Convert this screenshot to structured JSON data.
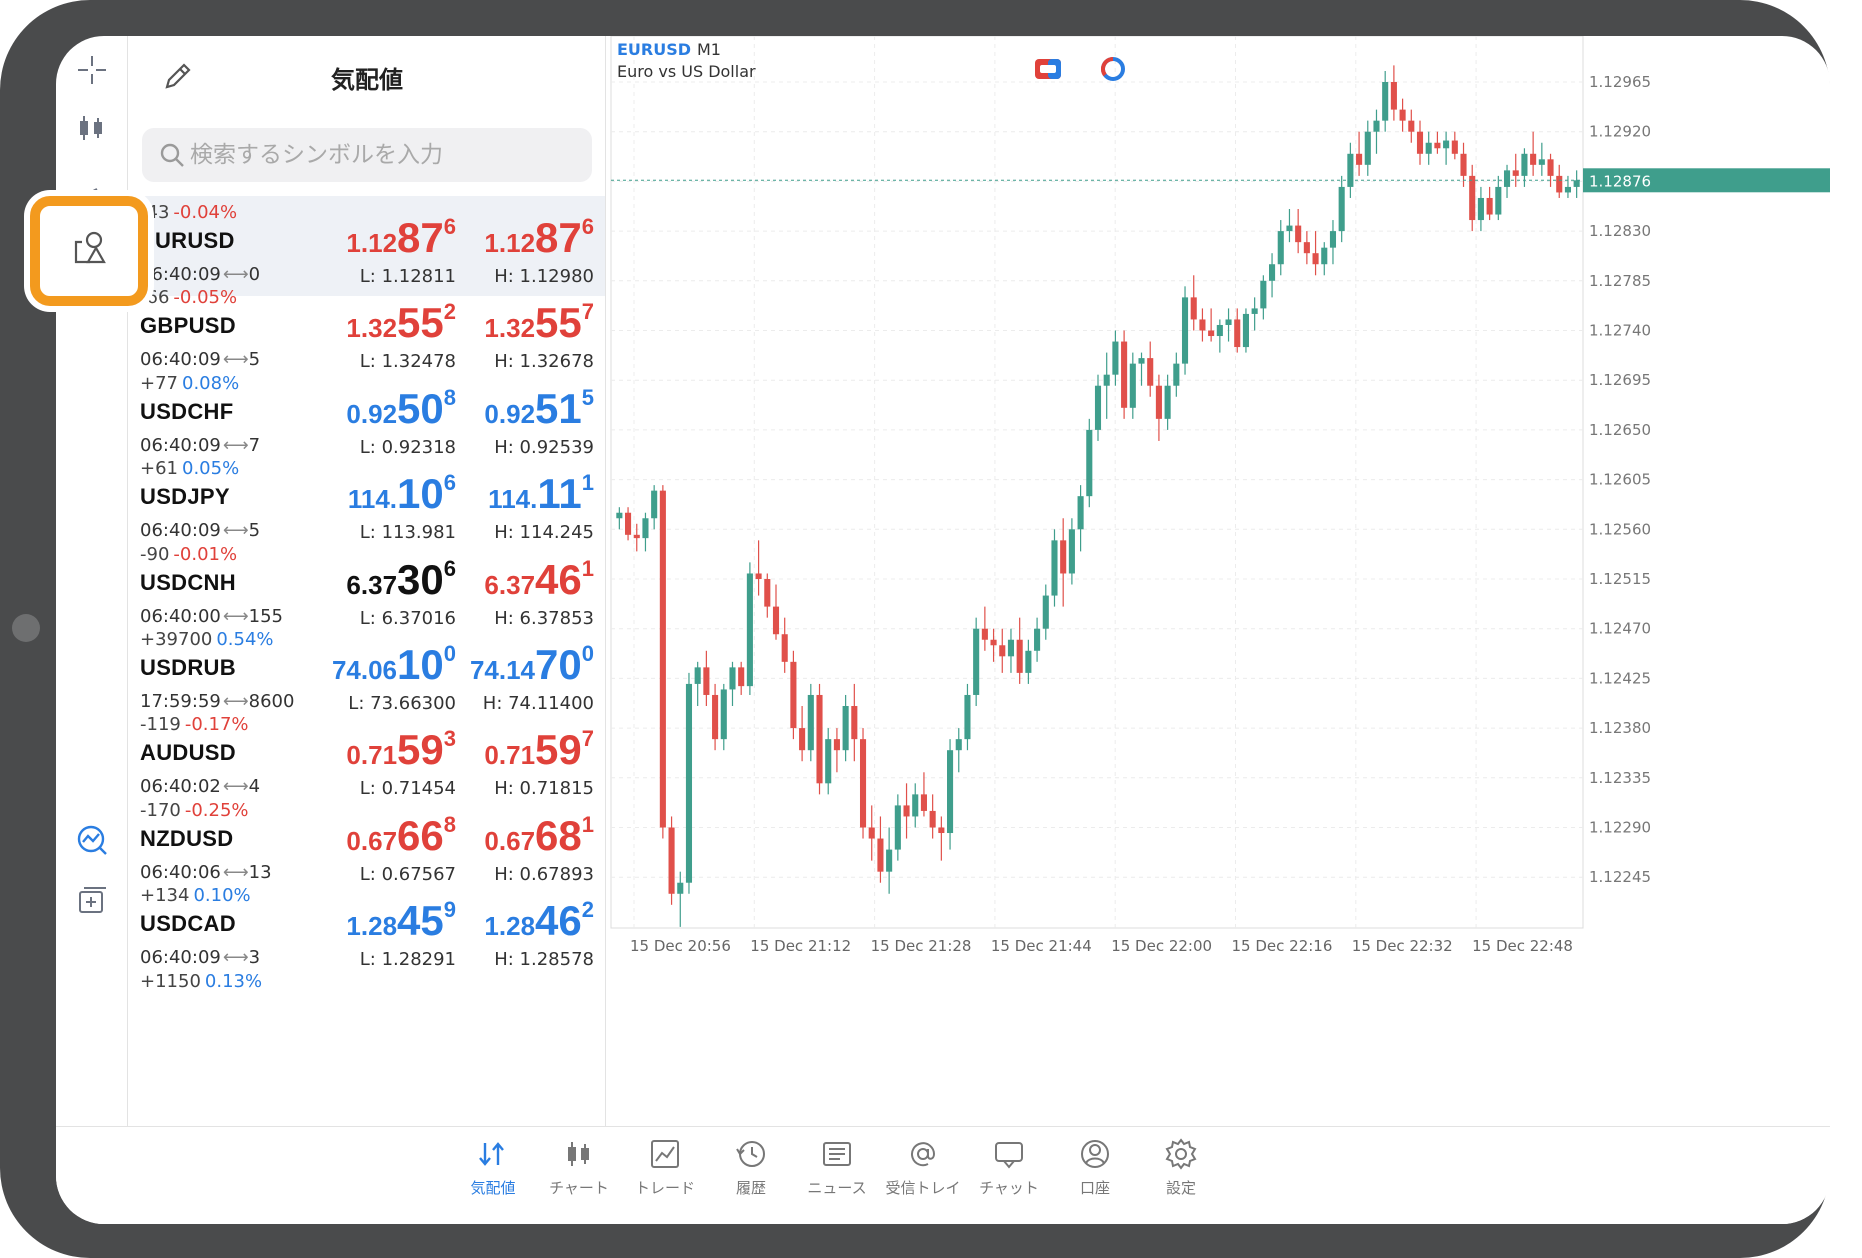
{
  "watchlist": {
    "title": "気配値",
    "search_placeholder": "検索するシンボルを入力",
    "rows": [
      {
        "change": "-43",
        "pct": "-0.04%",
        "pct_color": "red",
        "symbol": "EURUSD",
        "time": "06:40:09",
        "spread": "0",
        "bid": {
          "a": "1.12",
          "b": "87",
          "c": "6",
          "color": "red"
        },
        "ask": {
          "a": "1.12",
          "b": "87",
          "c": "6",
          "color": "red"
        },
        "low": "L: 1.12811",
        "high": "H: 1.12980"
      },
      {
        "change": "-66",
        "pct": "-0.05%",
        "pct_color": "red",
        "symbol": "GBPUSD",
        "time": "06:40:09",
        "spread": "5",
        "bid": {
          "a": "1.32",
          "b": "55",
          "c": "2",
          "color": "red"
        },
        "ask": {
          "a": "1.32",
          "b": "55",
          "c": "7",
          "color": "red"
        },
        "low": "L: 1.32478",
        "high": "H: 1.32678"
      },
      {
        "change": "+77",
        "pct": "0.08%",
        "pct_color": "blue",
        "symbol": "USDCHF",
        "time": "06:40:09",
        "spread": "7",
        "bid": {
          "a": "0.92",
          "b": "50",
          "c": "8",
          "color": "blue"
        },
        "ask": {
          "a": "0.92",
          "b": "51",
          "c": "5",
          "color": "blue"
        },
        "low": "L: 0.92318",
        "high": "H: 0.92539"
      },
      {
        "change": "+61",
        "pct": "0.05%",
        "pct_color": "blue",
        "symbol": "USDJPY",
        "time": "06:40:09",
        "spread": "5",
        "bid": {
          "a": "114.",
          "b": "10",
          "c": "6",
          "color": "blue"
        },
        "ask": {
          "a": "114.",
          "b": "11",
          "c": "1",
          "color": "blue"
        },
        "low": "L: 113.981",
        "high": "H: 114.245"
      },
      {
        "change": "-90",
        "pct": "-0.01%",
        "pct_color": "red",
        "symbol": "USDCNH",
        "time": "06:40:00",
        "spread": "155",
        "bid": {
          "a": "6.37",
          "b": "30",
          "c": "6",
          "color": "black"
        },
        "ask": {
          "a": "6.37",
          "b": "46",
          "c": "1",
          "color": "red"
        },
        "low": "L: 6.37016",
        "high": "H: 6.37853"
      },
      {
        "change": "+39700",
        "pct": "0.54%",
        "pct_color": "blue",
        "symbol": "USDRUB",
        "time": "17:59:59",
        "spread": "8600",
        "bid": {
          "a": "74.06",
          "b": "10",
          "c": "0",
          "color": "blue"
        },
        "ask": {
          "a": "74.14",
          "b": "70",
          "c": "0",
          "color": "blue"
        },
        "low": "L: 73.66300",
        "high": "H: 74.11400"
      },
      {
        "change": "-119",
        "pct": "-0.17%",
        "pct_color": "red",
        "symbol": "AUDUSD",
        "time": "06:40:02",
        "spread": "4",
        "bid": {
          "a": "0.71",
          "b": "59",
          "c": "3",
          "color": "red"
        },
        "ask": {
          "a": "0.71",
          "b": "59",
          "c": "7",
          "color": "red"
        },
        "low": "L: 0.71454",
        "high": "H: 0.71815"
      },
      {
        "change": "-170",
        "pct": "-0.25%",
        "pct_color": "red",
        "symbol": "NZDUSD",
        "time": "06:40:06",
        "spread": "13",
        "bid": {
          "a": "0.67",
          "b": "66",
          "c": "8",
          "color": "red"
        },
        "ask": {
          "a": "0.67",
          "b": "68",
          "c": "1",
          "color": "red"
        },
        "low": "L: 0.67567",
        "high": "H: 0.67893"
      },
      {
        "change": "+134",
        "pct": "0.10%",
        "pct_color": "blue",
        "symbol": "USDCAD",
        "time": "06:40:09",
        "spread": "3",
        "bid": {
          "a": "1.28",
          "b": "45",
          "c": "9",
          "color": "blue"
        },
        "ask": {
          "a": "1.28",
          "b": "46",
          "c": "2",
          "color": "blue"
        },
        "low": "L: 1.28291",
        "high": "H: 1.28578"
      },
      {
        "change": "+1150",
        "pct": "0.13%",
        "pct_color": "blue",
        "symbol": "",
        "time": "",
        "spread": "",
        "bid": {
          "a": "",
          "b": "",
          "c": "",
          "color": "blue"
        },
        "ask": {
          "a": "",
          "b": "",
          "c": "",
          "color": "blue"
        },
        "low": "",
        "high": ""
      }
    ]
  },
  "chart": {
    "symbol": "EURUSD",
    "timeframe": "M1",
    "description": "Euro vs US Dollar",
    "current_price_label": "1.12876",
    "current_price": 1.12876,
    "colors": {
      "up": "#3f9e8c",
      "down": "#e0504a",
      "price_line": "#3f9e8c"
    },
    "y_ticks": [
      "1.12965",
      "1.12920",
      "1.12875",
      "1.12830",
      "1.12785",
      "1.12740",
      "1.12695",
      "1.12650",
      "1.12605",
      "1.12560",
      "1.12515",
      "1.12470",
      "1.12425",
      "1.12380",
      "1.12335",
      "1.12290",
      "1.12245"
    ],
    "x_ticks": [
      "15 Dec 20:56",
      "15 Dec 21:12",
      "15 Dec 21:28",
      "15 Dec 21:44",
      "15 Dec 22:00",
      "15 Dec 22:16",
      "15 Dec 22:32",
      "15 Dec 22:48"
    ]
  },
  "chart_data": {
    "type": "candlestick",
    "x": [
      "20:56",
      "20:57",
      "20:58",
      "20:59",
      "21:00",
      "21:01",
      "21:02",
      "21:03",
      "21:04",
      "21:05",
      "21:06",
      "21:07",
      "21:08",
      "21:09",
      "21:10",
      "21:11",
      "21:12",
      "21:13",
      "21:14",
      "21:15",
      "21:16",
      "21:17",
      "21:18",
      "21:19",
      "21:20",
      "21:21",
      "21:22",
      "21:23",
      "21:24",
      "21:25",
      "21:26",
      "21:27",
      "21:28",
      "21:29",
      "21:30",
      "21:31",
      "21:32",
      "21:33",
      "21:34",
      "21:35",
      "21:36",
      "21:37",
      "21:38",
      "21:39",
      "21:40",
      "21:41",
      "21:42",
      "21:43",
      "21:44",
      "21:45",
      "21:46",
      "21:47",
      "21:48",
      "21:49",
      "21:50",
      "21:51",
      "21:52",
      "21:53",
      "21:54",
      "21:55",
      "21:56",
      "21:57",
      "21:58",
      "21:59",
      "22:00",
      "22:01",
      "22:02",
      "22:03",
      "22:04",
      "22:05",
      "22:06",
      "22:07",
      "22:08",
      "22:09",
      "22:10",
      "22:11",
      "22:12",
      "22:13",
      "22:14",
      "22:15",
      "22:16",
      "22:17",
      "22:18",
      "22:19",
      "22:20",
      "22:21",
      "22:22",
      "22:23",
      "22:24",
      "22:25",
      "22:26",
      "22:27",
      "22:28",
      "22:29",
      "22:30",
      "22:31",
      "22:32",
      "22:33",
      "22:34",
      "22:35",
      "22:36",
      "22:37",
      "22:38",
      "22:39",
      "22:40",
      "22:41",
      "22:42",
      "22:43",
      "22:44",
      "22:45",
      "22:46",
      "22:47",
      "22:48",
      "22:49",
      "22:50",
      "22:51",
      "22:52",
      "22:53",
      "22:54",
      "22:55",
      "22:56",
      "22:57",
      "22:58",
      "22:59",
      "23:00"
    ],
    "ohlc": [
      [
        1.1257,
        1.1258,
        1.1256,
        1.12575
      ],
      [
        1.12575,
        1.1258,
        1.1255,
        1.12555
      ],
      [
        1.12555,
        1.12565,
        1.1254,
        1.12552
      ],
      [
        1.12552,
        1.12575,
        1.1254,
        1.1257
      ],
      [
        1.1257,
        1.126,
        1.1256,
        1.12595
      ],
      [
        1.12595,
        1.126,
        1.1228,
        1.1229
      ],
      [
        1.1229,
        1.123,
        1.1222,
        1.1223
      ],
      [
        1.1223,
        1.1225,
        1.122,
        1.1224
      ],
      [
        1.1224,
        1.1243,
        1.1223,
        1.1242
      ],
      [
        1.1242,
        1.1244,
        1.124,
        1.12435
      ],
      [
        1.12435,
        1.1245,
        1.124,
        1.1241
      ],
      [
        1.1241,
        1.1242,
        1.1236,
        1.1237
      ],
      [
        1.1237,
        1.1242,
        1.1236,
        1.12415
      ],
      [
        1.12415,
        1.1244,
        1.124,
        1.12435
      ],
      [
        1.12435,
        1.1244,
        1.1241,
        1.12418
      ],
      [
        1.12418,
        1.1253,
        1.1241,
        1.1252
      ],
      [
        1.1252,
        1.1255,
        1.125,
        1.12515
      ],
      [
        1.12515,
        1.1252,
        1.1248,
        1.1249
      ],
      [
        1.1249,
        1.1251,
        1.1246,
        1.12465
      ],
      [
        1.12465,
        1.1248,
        1.1243,
        1.1244
      ],
      [
        1.1244,
        1.1245,
        1.1237,
        1.1238
      ],
      [
        1.1238,
        1.124,
        1.1235,
        1.1236
      ],
      [
        1.1236,
        1.1242,
        1.1235,
        1.1241
      ],
      [
        1.1241,
        1.1242,
        1.1232,
        1.1233
      ],
      [
        1.1233,
        1.1238,
        1.1232,
        1.1237
      ],
      [
        1.1237,
        1.1238,
        1.1234,
        1.1236
      ],
      [
        1.1236,
        1.1241,
        1.1235,
        1.124
      ],
      [
        1.124,
        1.1242,
        1.1235,
        1.1237
      ],
      [
        1.1237,
        1.1238,
        1.1228,
        1.1229
      ],
      [
        1.1229,
        1.1231,
        1.1226,
        1.1228
      ],
      [
        1.1228,
        1.123,
        1.1224,
        1.1225
      ],
      [
        1.1225,
        1.1229,
        1.1223,
        1.1227
      ],
      [
        1.1227,
        1.1232,
        1.1226,
        1.1231
      ],
      [
        1.1231,
        1.1233,
        1.1228,
        1.123
      ],
      [
        1.123,
        1.1233,
        1.1229,
        1.1232
      ],
      [
        1.1232,
        1.1234,
        1.123,
        1.12305
      ],
      [
        1.12305,
        1.1232,
        1.1228,
        1.1229
      ],
      [
        1.1229,
        1.123,
        1.1226,
        1.12285
      ],
      [
        1.12285,
        1.1237,
        1.1227,
        1.1236
      ],
      [
        1.1236,
        1.1238,
        1.1234,
        1.1237
      ],
      [
        1.1237,
        1.1242,
        1.1236,
        1.1241
      ],
      [
        1.1241,
        1.1248,
        1.124,
        1.1247
      ],
      [
        1.1247,
        1.1249,
        1.1245,
        1.1246
      ],
      [
        1.1246,
        1.1247,
        1.1244,
        1.12455
      ],
      [
        1.12455,
        1.1247,
        1.1243,
        1.12445
      ],
      [
        1.12445,
        1.1247,
        1.1243,
        1.1246
      ],
      [
        1.1246,
        1.1248,
        1.1242,
        1.1243
      ],
      [
        1.1243,
        1.1246,
        1.1242,
        1.1245
      ],
      [
        1.1245,
        1.1248,
        1.1244,
        1.1247
      ],
      [
        1.1247,
        1.1251,
        1.1246,
        1.125
      ],
      [
        1.125,
        1.1256,
        1.1249,
        1.1255
      ],
      [
        1.1255,
        1.1257,
        1.1249,
        1.1252
      ],
      [
        1.1252,
        1.1257,
        1.1251,
        1.1256
      ],
      [
        1.1256,
        1.126,
        1.1254,
        1.1259
      ],
      [
        1.1259,
        1.1266,
        1.1258,
        1.1265
      ],
      [
        1.1265,
        1.127,
        1.1264,
        1.1269
      ],
      [
        1.1269,
        1.1272,
        1.1266,
        1.127
      ],
      [
        1.127,
        1.1274,
        1.1269,
        1.1273
      ],
      [
        1.1273,
        1.1274,
        1.1266,
        1.1267
      ],
      [
        1.1267,
        1.1272,
        1.1266,
        1.1271
      ],
      [
        1.1271,
        1.1272,
        1.1269,
        1.12715
      ],
      [
        1.12715,
        1.1273,
        1.1268,
        1.1269
      ],
      [
        1.1269,
        1.127,
        1.1264,
        1.1266
      ],
      [
        1.1266,
        1.127,
        1.1265,
        1.1269
      ],
      [
        1.1269,
        1.1272,
        1.1268,
        1.1271
      ],
      [
        1.1271,
        1.1278,
        1.127,
        1.1277
      ],
      [
        1.1277,
        1.1279,
        1.1274,
        1.1275
      ],
      [
        1.1275,
        1.1276,
        1.1273,
        1.1274
      ],
      [
        1.1274,
        1.1276,
        1.1273,
        1.12735
      ],
      [
        1.12735,
        1.1275,
        1.1272,
        1.12745
      ],
      [
        1.12745,
        1.1276,
        1.1273,
        1.1275
      ],
      [
        1.1275,
        1.1276,
        1.1272,
        1.12725
      ],
      [
        1.12725,
        1.1276,
        1.1272,
        1.12755
      ],
      [
        1.12755,
        1.1277,
        1.1274,
        1.1276
      ],
      [
        1.1276,
        1.1279,
        1.1275,
        1.12785
      ],
      [
        1.12785,
        1.1281,
        1.1277,
        1.128
      ],
      [
        1.128,
        1.1284,
        1.1279,
        1.1283
      ],
      [
        1.1283,
        1.1285,
        1.1282,
        1.12835
      ],
      [
        1.12835,
        1.1285,
        1.1281,
        1.1282
      ],
      [
        1.1282,
        1.1283,
        1.128,
        1.1281
      ],
      [
        1.1281,
        1.1283,
        1.1279,
        1.128
      ],
      [
        1.128,
        1.1282,
        1.1279,
        1.12815
      ],
      [
        1.12815,
        1.1284,
        1.128,
        1.1283
      ],
      [
        1.1283,
        1.1288,
        1.1282,
        1.1287
      ],
      [
        1.1287,
        1.1291,
        1.1286,
        1.129
      ],
      [
        1.129,
        1.1292,
        1.1288,
        1.1289
      ],
      [
        1.1289,
        1.1293,
        1.1288,
        1.1292
      ],
      [
        1.1292,
        1.1294,
        1.129,
        1.1293
      ],
      [
        1.1293,
        1.12975,
        1.1292,
        1.12965
      ],
      [
        1.12965,
        1.1298,
        1.1293,
        1.1294
      ],
      [
        1.1294,
        1.1295,
        1.1292,
        1.1293
      ],
      [
        1.1293,
        1.1294,
        1.1291,
        1.1292
      ],
      [
        1.1292,
        1.1293,
        1.1289,
        1.129
      ],
      [
        1.129,
        1.1292,
        1.1289,
        1.1291
      ],
      [
        1.1291,
        1.1292,
        1.129,
        1.12905
      ],
      [
        1.12905,
        1.1292,
        1.1289,
        1.12912
      ],
      [
        1.12912,
        1.1292,
        1.12895,
        1.129
      ],
      [
        1.129,
        1.1291,
        1.1287,
        1.1288
      ],
      [
        1.1288,
        1.1289,
        1.1283,
        1.1284
      ],
      [
        1.1284,
        1.1287,
        1.1283,
        1.1286
      ],
      [
        1.1286,
        1.1287,
        1.1284,
        1.12845
      ],
      [
        1.12845,
        1.1288,
        1.1284,
        1.1287
      ],
      [
        1.1287,
        1.1289,
        1.1286,
        1.12885
      ],
      [
        1.12885,
        1.129,
        1.1287,
        1.1288
      ],
      [
        1.1288,
        1.12905,
        1.1287,
        1.129
      ],
      [
        1.129,
        1.1292,
        1.1288,
        1.1289
      ],
      [
        1.1289,
        1.1291,
        1.1288,
        1.12895
      ],
      [
        1.12895,
        1.129,
        1.1287,
        1.1288
      ],
      [
        1.1288,
        1.1289,
        1.1286,
        1.12865
      ],
      [
        1.12865,
        1.1288,
        1.1286,
        1.1287
      ],
      [
        1.1287,
        1.12885,
        1.1286,
        1.12876
      ]
    ],
    "ylim": [
      1.122,
      1.12985
    ]
  },
  "tabs": [
    {
      "label": "気配値",
      "icon": "quotes-icon",
      "active": true
    },
    {
      "label": "チャート",
      "icon": "chart-icon",
      "active": false
    },
    {
      "label": "トレード",
      "icon": "trade-icon",
      "active": false
    },
    {
      "label": "履歴",
      "icon": "history-icon",
      "active": false
    },
    {
      "label": "ニュース",
      "icon": "news-icon",
      "active": false
    },
    {
      "label": "受信トレイ",
      "icon": "mailbox-icon",
      "active": false
    },
    {
      "label": "チャット",
      "icon": "chat-icon",
      "active": false
    },
    {
      "label": "口座",
      "icon": "account-icon",
      "active": false
    },
    {
      "label": "設定",
      "icon": "settings-icon",
      "active": false
    }
  ]
}
